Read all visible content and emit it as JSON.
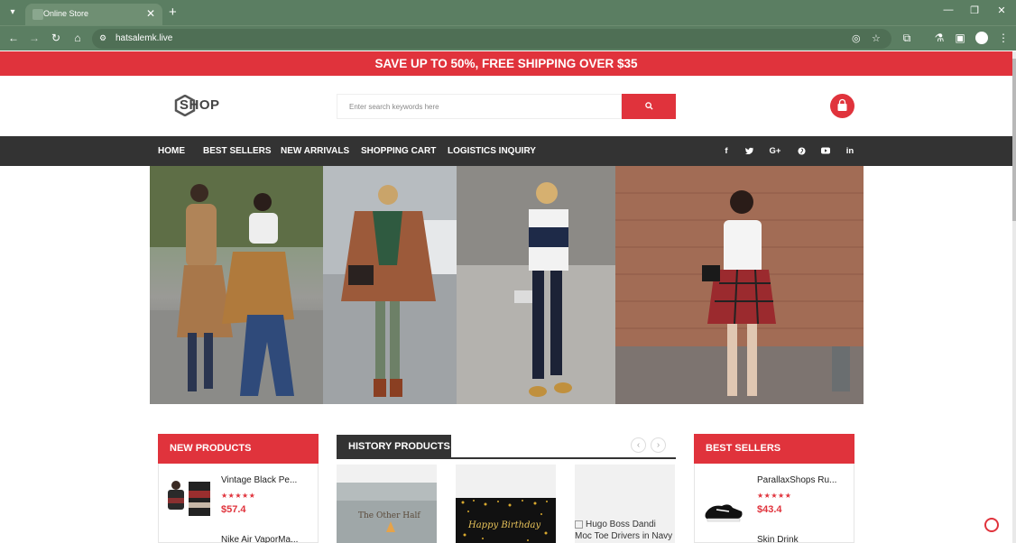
{
  "browser": {
    "tab_title": "Online Store",
    "url": "hatsalemk.live"
  },
  "colors": {
    "accent": "#e0333c",
    "menu_bg": "#333333",
    "chrome": "#5b7e62"
  },
  "promo_banner": "SAVE UP TO 50%, FREE SHIPPING OVER $35",
  "header": {
    "logo_text": "SHOP",
    "search_placeholder": "Enter search keywords here"
  },
  "menu": {
    "items": [
      "HOME",
      "BEST SELLERS",
      "NEW ARRIVALS",
      "SHOPPING CART",
      "LOGISTICS INQUIRY"
    ],
    "social": [
      "f",
      "t",
      "G+",
      "p",
      "yt",
      "in"
    ]
  },
  "new_products": {
    "title": "NEW PRODUCTS",
    "items": [
      {
        "name": "Vintage Black Pe...",
        "stars": "★★★★★",
        "price": "$57.4"
      },
      {
        "name": "Nike Air VaporMa..."
      }
    ]
  },
  "history_products": {
    "title": "HISTORY PRODUCTS",
    "prev": "‹",
    "next": "›",
    "cards": [
      {
        "image_text": "The Other Half"
      },
      {
        "image_text": "Happy Birthday"
      },
      {
        "alt_text": "Hugo Boss Dandi Moc Toe Drivers in Navy Suede"
      }
    ]
  },
  "best_sellers": {
    "title": "BEST SELLERS",
    "items": [
      {
        "name": "ParallaxShops Ru...",
        "stars": "★★★★★",
        "price": "$43.4"
      },
      {
        "name": "Skin Drink"
      }
    ]
  }
}
